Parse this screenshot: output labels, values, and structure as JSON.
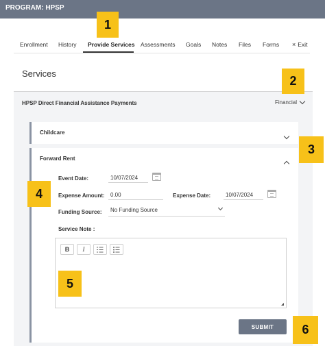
{
  "program_title": "PROGRAM: HPSP",
  "tabs": [
    {
      "label": "Enrollment"
    },
    {
      "label": "History"
    },
    {
      "label": "Provide Services"
    },
    {
      "label": "Assessments"
    },
    {
      "label": "Goals"
    },
    {
      "label": "Notes"
    },
    {
      "label": "Files"
    },
    {
      "label": "Forms"
    },
    {
      "label": "Exit"
    }
  ],
  "active_tab": "Provide Services",
  "exit_icon": "×",
  "section_title": "Services",
  "accordion": {
    "title": "HPSP Direct Financial Assistance Payments",
    "category": "Financial"
  },
  "childcare": {
    "label": "Childcare"
  },
  "forward_rent": {
    "label": "Forward Rent",
    "event_date_label": "Event Date:",
    "event_date_value": "10/07/2024",
    "expense_amount_label": "Expense Amount:",
    "expense_amount_value": "0.00",
    "expense_date_label": "Expense Date:",
    "expense_date_value": "10/07/2024",
    "funding_source_label": "Funding Source:",
    "funding_source_value": "No Funding Source",
    "service_note_label": "Service Note :"
  },
  "editor_toolbar": {
    "bold": "B",
    "italic": "I"
  },
  "submit_label": "SUBMIT",
  "callouts": [
    "1",
    "2",
    "3",
    "4",
    "5",
    "6"
  ],
  "colors": {
    "header_bg": "#6b7586",
    "callout": "#f7c119",
    "panel_bg": "#f3f4f6"
  }
}
